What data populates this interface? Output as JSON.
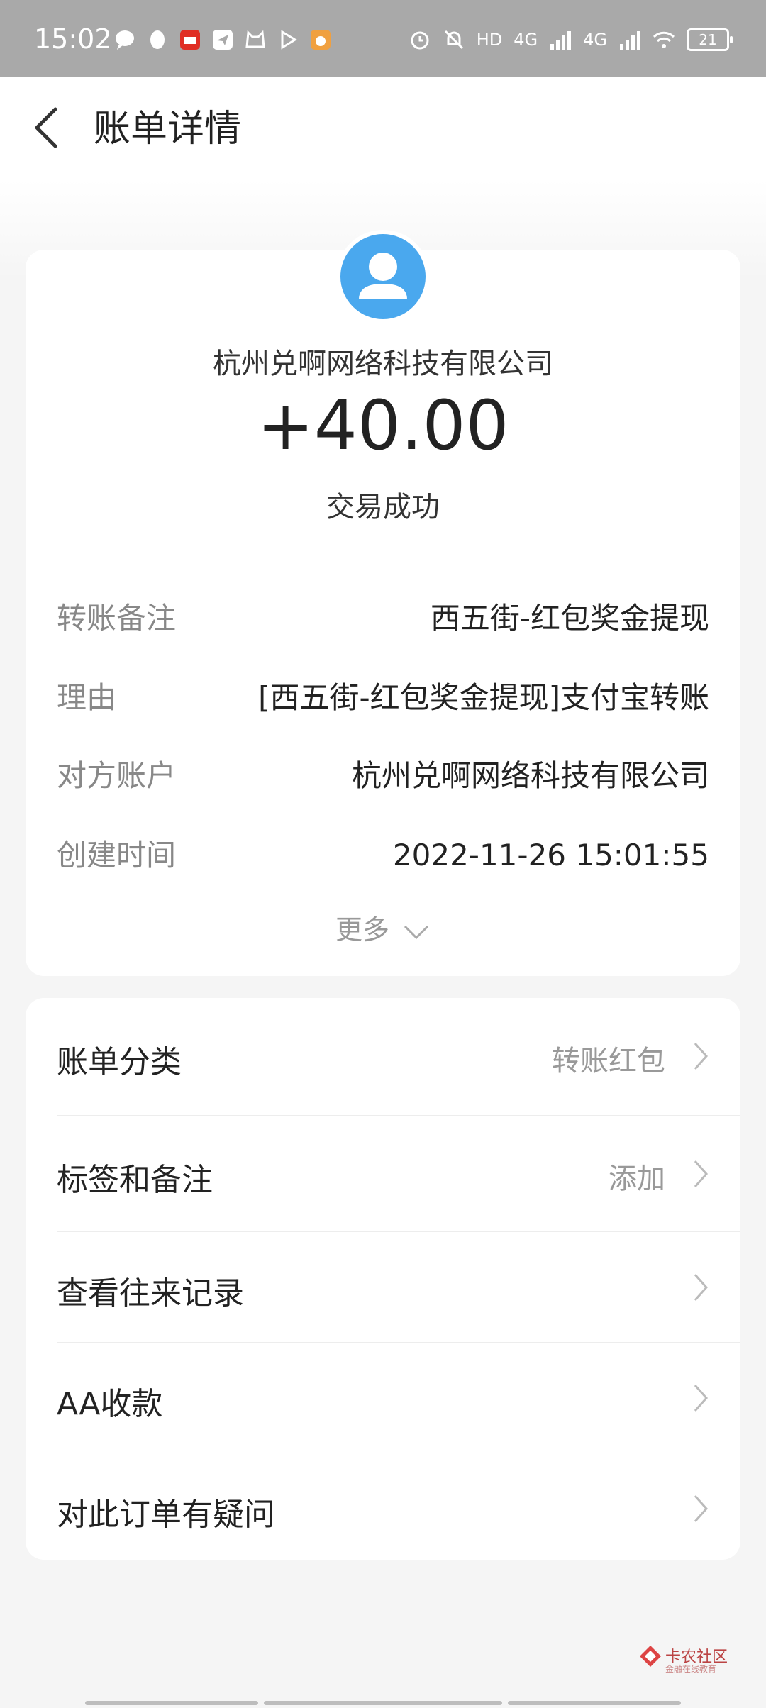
{
  "status_bar": {
    "time": "15:02",
    "network_1": "4G",
    "network_2": "4G",
    "hd": "HD",
    "battery": "21"
  },
  "header": {
    "title": "账单详情"
  },
  "bill": {
    "merchant": "杭州兑啊网络科技有限公司",
    "amount": "+40.00",
    "status": "交易成功",
    "details": [
      {
        "label": "转账备注",
        "value": "西五街-红包奖金提现"
      },
      {
        "label": "理由",
        "value": "[西五街-红包奖金提现]支付宝转账"
      },
      {
        "label": "对方账户",
        "value": "杭州兑啊网络科技有限公司"
      },
      {
        "label": "创建时间",
        "value": "2022-11-26 15:01:55"
      }
    ],
    "more_label": "更多"
  },
  "menu": {
    "items": [
      {
        "label": "账单分类",
        "value": "转账红包"
      },
      {
        "label": "标签和备注",
        "value": "添加"
      },
      {
        "label": "查看往来记录",
        "value": ""
      },
      {
        "label": "AA收款",
        "value": ""
      },
      {
        "label": "对此订单有疑问",
        "value": ""
      }
    ]
  },
  "watermark": {
    "text": "卡农社区",
    "subtext": "金融在线教育"
  },
  "colors": {
    "accent_blue": "#4aa8ee",
    "status_bar_bg": "#a9a9a9",
    "page_bg": "#f5f5f5"
  }
}
